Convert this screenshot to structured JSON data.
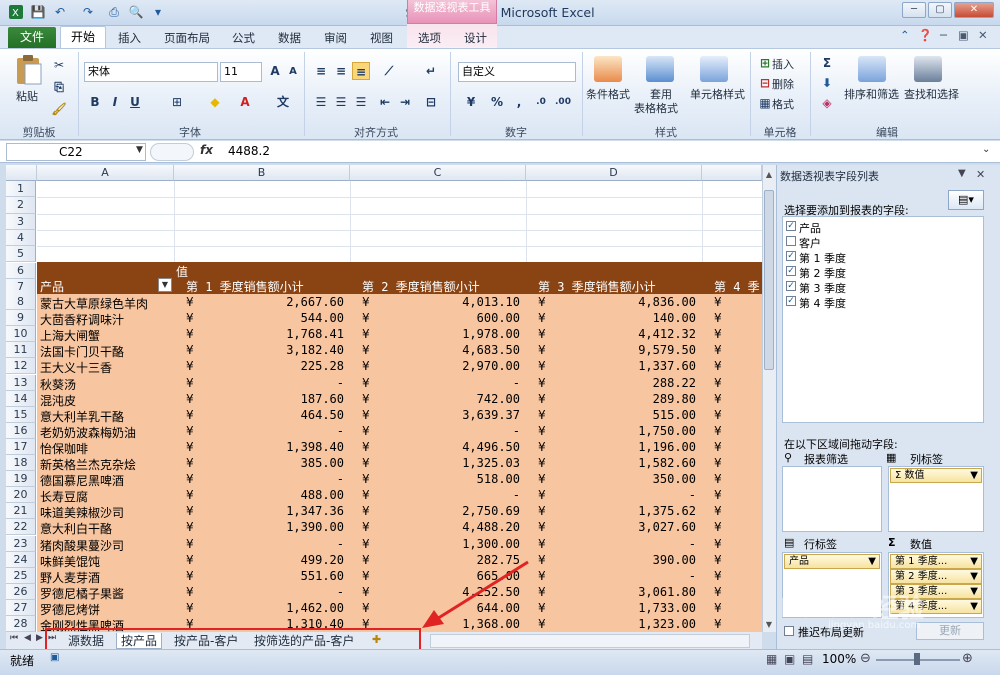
{
  "window": {
    "title": "SalesReport1  -  Microsoft Excel",
    "context_tab_header": "数据透视表工具"
  },
  "ribbon": {
    "file_tab": "文件",
    "tabs": [
      "开始",
      "插入",
      "页面布局",
      "公式",
      "数据",
      "审阅",
      "视图",
      "选项",
      "设计"
    ],
    "groups": {
      "clipboard": "剪贴板",
      "font": "字体",
      "alignment": "对齐方式",
      "number": "数字",
      "styles": "样式",
      "cells": "单元格",
      "editing": "编辑"
    },
    "paste_label": "粘贴",
    "font_name": "宋体",
    "font_size": "11",
    "number_format": "自定义",
    "cond_format": "条件格式",
    "table_format_1": "套用",
    "table_format_2": "表格格式",
    "cell_styles": "单元格样式",
    "insert": "插入",
    "delete": "删除",
    "format": "格式",
    "sort_filter": "排序和筛选",
    "find_select": "查找和选择"
  },
  "formula_bar": {
    "name_box": "C22",
    "fx": "fx",
    "value": "4488.2"
  },
  "sheet": {
    "columns": [
      "A",
      "B",
      "C",
      "D"
    ],
    "rows_top": [
      "1",
      "2",
      "3",
      "4",
      "5",
      "6",
      "7"
    ],
    "values_label": "值",
    "pivot_row_label": "产品",
    "value_headers": [
      "第 1 季度销售额小计",
      "第 2 季度销售额小计",
      "第 3 季度销售额小计",
      "第 4 季"
    ],
    "currency": "¥",
    "data": [
      {
        "row": "8",
        "name": "蒙古大草原绿色羊肉",
        "q1": "2,667.60",
        "q2": "4,013.10",
        "q3": "4,836.00"
      },
      {
        "row": "9",
        "name": "大茴香籽调味汁",
        "q1": "544.00",
        "q2": "600.00",
        "q3": "140.00"
      },
      {
        "row": "10",
        "name": "上海大闸蟹",
        "q1": "1,768.41",
        "q2": "1,978.00",
        "q3": "4,412.32"
      },
      {
        "row": "11",
        "name": "法国卡门贝干酪",
        "q1": "3,182.40",
        "q2": "4,683.50",
        "q3": "9,579.50"
      },
      {
        "row": "12",
        "name": "王大义十三香",
        "q1": "225.28",
        "q2": "2,970.00",
        "q3": "1,337.60"
      },
      {
        "row": "13",
        "name": "秋葵汤",
        "q1": "-",
        "q2": "-",
        "q3": "288.22"
      },
      {
        "row": "14",
        "name": "混沌皮",
        "q1": "187.60",
        "q2": "742.00",
        "q3": "289.80"
      },
      {
        "row": "15",
        "name": "意大利羊乳干酪",
        "q1": "464.50",
        "q2": "3,639.37",
        "q3": "515.00"
      },
      {
        "row": "16",
        "name": "老奶奶波森梅奶油",
        "q1": "-",
        "q2": "-",
        "q3": "1,750.00"
      },
      {
        "row": "17",
        "name": "怡保咖啡",
        "q1": "1,398.40",
        "q2": "4,496.50",
        "q3": "1,196.00"
      },
      {
        "row": "18",
        "name": "新英格兰杰克杂烩",
        "q1": "385.00",
        "q2": "1,325.03",
        "q3": "1,582.60"
      },
      {
        "row": "19",
        "name": "德国慕尼黑啤酒",
        "q1": "-",
        "q2": "518.00",
        "q3": "350.00"
      },
      {
        "row": "20",
        "name": "长寿豆腐",
        "q1": "488.00",
        "q2": "-",
        "q3": "-"
      },
      {
        "row": "21",
        "name": "味道美辣椒沙司",
        "q1": "1,347.36",
        "q2": "2,750.69",
        "q3": "1,375.62"
      },
      {
        "row": "22",
        "name": "意大利白干酪",
        "q1": "1,390.00",
        "q2": "4,488.20",
        "q3": "3,027.60"
      },
      {
        "row": "23",
        "name": "猪肉酸果蔓沙司",
        "q1": "-",
        "q2": "1,300.00",
        "q3": "-"
      },
      {
        "row": "24",
        "name": "味鲜美馄饨",
        "q1": "499.20",
        "q2": "282.75",
        "q3": "390.00"
      },
      {
        "row": "25",
        "name": "野人麦芽酒",
        "q1": "551.60",
        "q2": "665.00",
        "q3": "-"
      },
      {
        "row": "26",
        "name": "罗德尼橘子果酱",
        "q1": "-",
        "q2": "4,252.50",
        "q3": "3,061.80"
      },
      {
        "row": "27",
        "name": "罗德尼烤饼",
        "q1": "1,462.00",
        "q2": "644.00",
        "q3": "1,733.00"
      },
      {
        "row": "28",
        "name": "金刚烈性黑啤酒",
        "q1": "1,310.40",
        "q2": "1,368.00",
        "q3": "1,323.00"
      }
    ]
  },
  "sheet_tabs": [
    "源数据",
    "按产品",
    "按产品-客户",
    "按筛选的产品-客户"
  ],
  "status": {
    "ready": "就绪",
    "zoom": "100%"
  },
  "pivot_pane": {
    "title": "数据透视表字段列表",
    "choose_fields": "选择要添加到报表的字段:",
    "fields": [
      {
        "label": "产品",
        "checked": true
      },
      {
        "label": "客户",
        "checked": false
      },
      {
        "label": "第 1 季度",
        "checked": true
      },
      {
        "label": "第 2 季度",
        "checked": true
      },
      {
        "label": "第 3 季度",
        "checked": true
      },
      {
        "label": "第 4 季度",
        "checked": true
      }
    ],
    "drag_areas": "在以下区域间拖动字段:",
    "report_filter": "报表筛选",
    "col_labels": "列标签",
    "row_labels": "行标签",
    "values": "数值",
    "col_item": "Σ 数值",
    "row_item": "产品",
    "value_items": [
      "第 1 季度...",
      "第 2 季度...",
      "第 3 季度...",
      "第 4 季度..."
    ],
    "defer_update": "推迟布局更新",
    "update_btn": "更新"
  },
  "watermark": "Baidu 经验",
  "watermark_url": "jingyan.baidu.com",
  "colors": {
    "pivot_header": "#8a4414",
    "pivot_body": "#f7c59f",
    "highlight_box": "#e02323"
  }
}
